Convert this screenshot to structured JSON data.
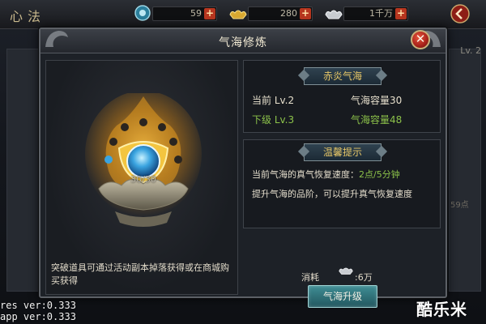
{
  "topbar": {
    "logo": "心法",
    "resources": [
      {
        "icon": "jade-coin-icon",
        "value": "59"
      },
      {
        "icon": "gold-ingot-icon",
        "value": "280"
      },
      {
        "icon": "silver-ingot-icon",
        "value": "1千万"
      }
    ]
  },
  "background": {
    "level_label": "Lv. 2",
    "side_value": "59点"
  },
  "dialog": {
    "title": "气海修炼",
    "close_label": "✕",
    "left": {
      "progress": "30/30",
      "hint": "突破道具可通过活动副本掉落获得或在商城购买获得"
    },
    "info_section": {
      "banner": "赤炎气海",
      "current_level": "当前 Lv.2",
      "current_capacity": "气海容量30",
      "next_level": "下级 Lv.3",
      "next_capacity": "气海容量48"
    },
    "tips_section": {
      "banner": "温馨提示",
      "line1_prefix": "当前气海的真气恢复速度：",
      "line1_value": "2点/5分钟",
      "line2": "提升气海的品阶，可以提升真气恢复速度"
    },
    "cost": {
      "label": "消耗",
      "value": ":6万"
    },
    "upgrade_button": "气海升级"
  },
  "debug": {
    "res_ver": "res ver:0.333",
    "app_ver": "app ver:0.333"
  },
  "watermark": "酷乐米",
  "colors": {
    "green_text": "#8cc24a",
    "banner_text": "#e7c767",
    "close_red": "#a8221a"
  }
}
